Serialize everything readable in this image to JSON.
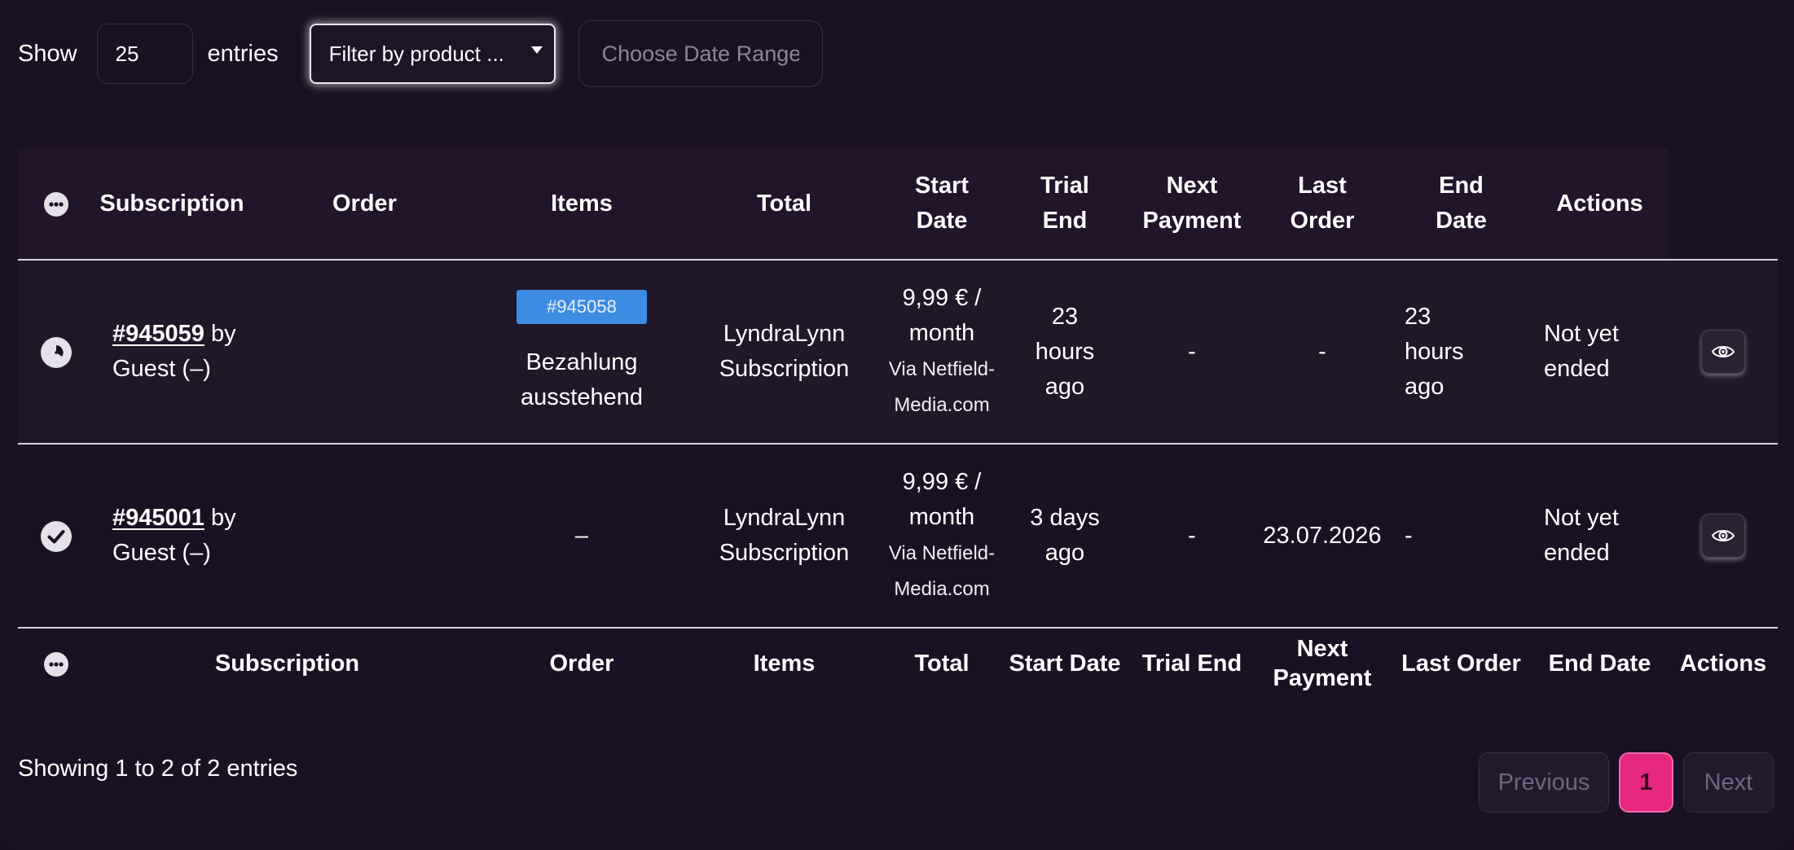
{
  "controls": {
    "show_label": "Show",
    "entries_value": "25",
    "entries_label": "entries",
    "filter_label": "Filter by product ...",
    "date_placeholder": "Choose Date Range"
  },
  "columns": [
    "Subscription",
    "Order",
    "Items",
    "Total",
    "Start Date",
    "Trial End",
    "Next Payment",
    "Last Order",
    "End Date",
    "Actions"
  ],
  "header_wrapped": {
    "start_date": [
      "Start",
      "Date"
    ],
    "trial_end": [
      "Trial",
      "End"
    ],
    "next_payment": [
      "Next",
      "Payment"
    ],
    "last_order": [
      "Last",
      "Order"
    ],
    "end_date": [
      "End",
      "Date"
    ]
  },
  "rows": [
    {
      "status_icon": "clock-icon",
      "subscription_id": "#945059",
      "by_text": "by",
      "customer": "Guest (–)",
      "order_badge": "#945058",
      "order_status_line1": "Bezahlung",
      "order_status_line2": "ausstehend",
      "items_line1": "LyndraLynn",
      "items_line2": "Subscription",
      "total_line1": "9,99 € /",
      "total_line2": "month",
      "via_line1": "Via Netfield-",
      "via_line2": "Media.com",
      "start_line1": "23",
      "start_line2": "hours",
      "start_line3": "ago",
      "trial_end": "-",
      "next_payment": "-",
      "last_order_line1": "23",
      "last_order_line2": "hours",
      "last_order_line3": "ago",
      "end_line1": "Not yet",
      "end_line2": "ended"
    },
    {
      "status_icon": "check-icon",
      "subscription_id": "#945001",
      "by_text": "by",
      "customer": "Guest (–)",
      "order": "–",
      "items_line1": "LyndraLynn",
      "items_line2": "Subscription",
      "total_line1": "9,99 € /",
      "total_line2": "month",
      "via_line1": "Via Netfield-",
      "via_line2": "Media.com",
      "start_line1": "3 days",
      "start_line2": "ago",
      "trial_end": "-",
      "next_payment": "23.07.2026",
      "last_order": "-",
      "end_line1": "Not yet",
      "end_line2": "ended"
    }
  ],
  "footer": {
    "info": "Showing 1 to 2 of 2 entries",
    "previous": "Previous",
    "current_page": "1",
    "next": "Next"
  },
  "colors": {
    "background": "#1b1124",
    "order_badge": "#3d8ce4",
    "active_page": "#e6287e"
  }
}
